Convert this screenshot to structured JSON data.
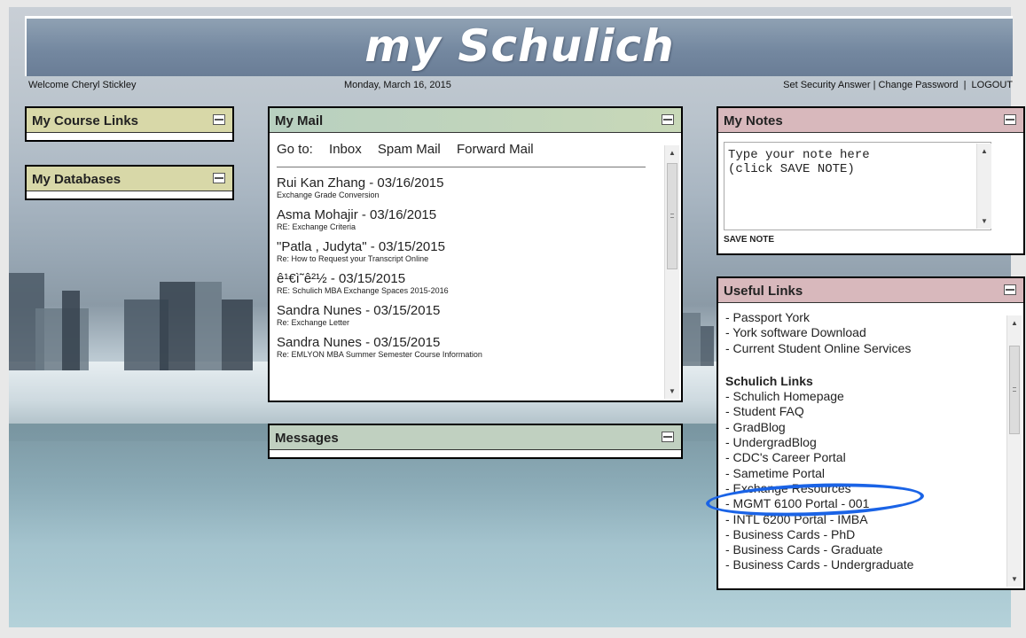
{
  "header": {
    "title": "my Schulich"
  },
  "infobar": {
    "welcome": "Welcome Cheryl Stickley",
    "date": "Monday, March 16, 2015",
    "security": "Set Security Answer",
    "change_password": "Change Password",
    "sep1": "|",
    "sep2": "|",
    "logout": "LOGOUT"
  },
  "panels": {
    "course_links": {
      "title": "My Course Links"
    },
    "databases": {
      "title": "My Databases"
    },
    "messages": {
      "title": "Messages"
    },
    "mail": {
      "title": "My Mail",
      "goto_label": "Go to:",
      "goto_links": [
        "Inbox",
        "Spam Mail",
        "Forward Mail"
      ],
      "items": [
        {
          "sender": "Rui Kan Zhang - 03/16/2015",
          "subject": "Exchange Grade Conversion"
        },
        {
          "sender": "Asma Mohajir - 03/16/2015",
          "subject": "RE: Exchange Criteria"
        },
        {
          "sender": "\"Patla , Judyta\" - 03/15/2015",
          "subject": "Re: How to Request your Transcript Online"
        },
        {
          "sender": "ê¹€ì˜ê²½ - 03/15/2015",
          "subject": "RE: Schulich MBA Exchange Spaces 2015-2016"
        },
        {
          "sender": "Sandra Nunes - 03/15/2015",
          "subject": "Re: Exchange Letter"
        },
        {
          "sender": "Sandra Nunes - 03/15/2015",
          "subject": "Re: EMLYON MBA Summer Semester Course Information"
        }
      ]
    },
    "notes": {
      "title": "My Notes",
      "text": "Type your note here\n(click SAVE NOTE)",
      "save_label": "SAVE NOTE"
    },
    "useful_links": {
      "title": "Useful Links",
      "general": [
        "- Passport York",
        "- York software Download",
        "- Current Student Online Services"
      ],
      "schulich_heading": "Schulich Links",
      "schulich": [
        "- Schulich Homepage",
        "- Student FAQ",
        "- GradBlog",
        "- UndergradBlog",
        "- CDC's Career Portal",
        "- Sametime Portal",
        "- Exchange Resources",
        "- MGMT 6100 Portal - 001",
        "- INTL 6200 Portal - IMBA",
        "- Business Cards - PhD",
        "- Business Cards - Graduate",
        "- Business Cards - Undergraduate"
      ]
    }
  },
  "icons": {
    "minimize": "minimize-icon",
    "scroll_up": "scroll-up-icon",
    "scroll_down": "scroll-down-icon"
  },
  "colors": {
    "highlight": "#1a63e6",
    "header_bg": "#7488a0"
  }
}
